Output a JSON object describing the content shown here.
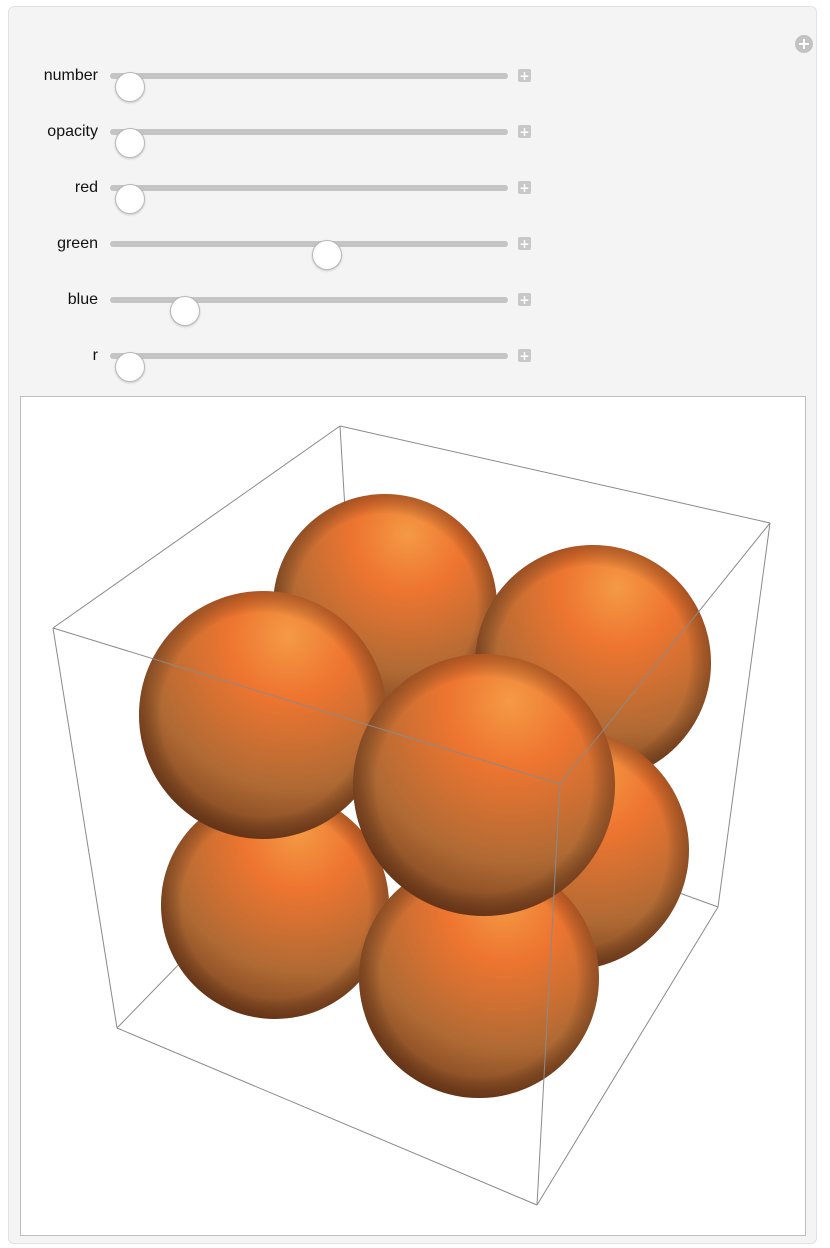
{
  "controls": [
    {
      "id": "number",
      "label": "number",
      "value": 0.0
    },
    {
      "id": "opacity",
      "label": "opacity",
      "value": 0.0
    },
    {
      "id": "red",
      "label": "red",
      "value": 0.0
    },
    {
      "id": "green",
      "label": "green",
      "value": 0.55
    },
    {
      "id": "blue",
      "label": "blue",
      "value": 0.155
    },
    {
      "id": "r",
      "label": "r",
      "value": 0.0
    }
  ],
  "colors": {
    "sphere_highlight": "#f49a45",
    "sphere_base": "#ee7530",
    "sphere_mid": "#b06a34",
    "sphere_shadow": "#5a2a12",
    "box_edge": "#8a8a8a",
    "panel_bg": "#f4f4f4"
  },
  "icons": {
    "options": "plus-circle-icon",
    "step": "plus-square-icon"
  }
}
